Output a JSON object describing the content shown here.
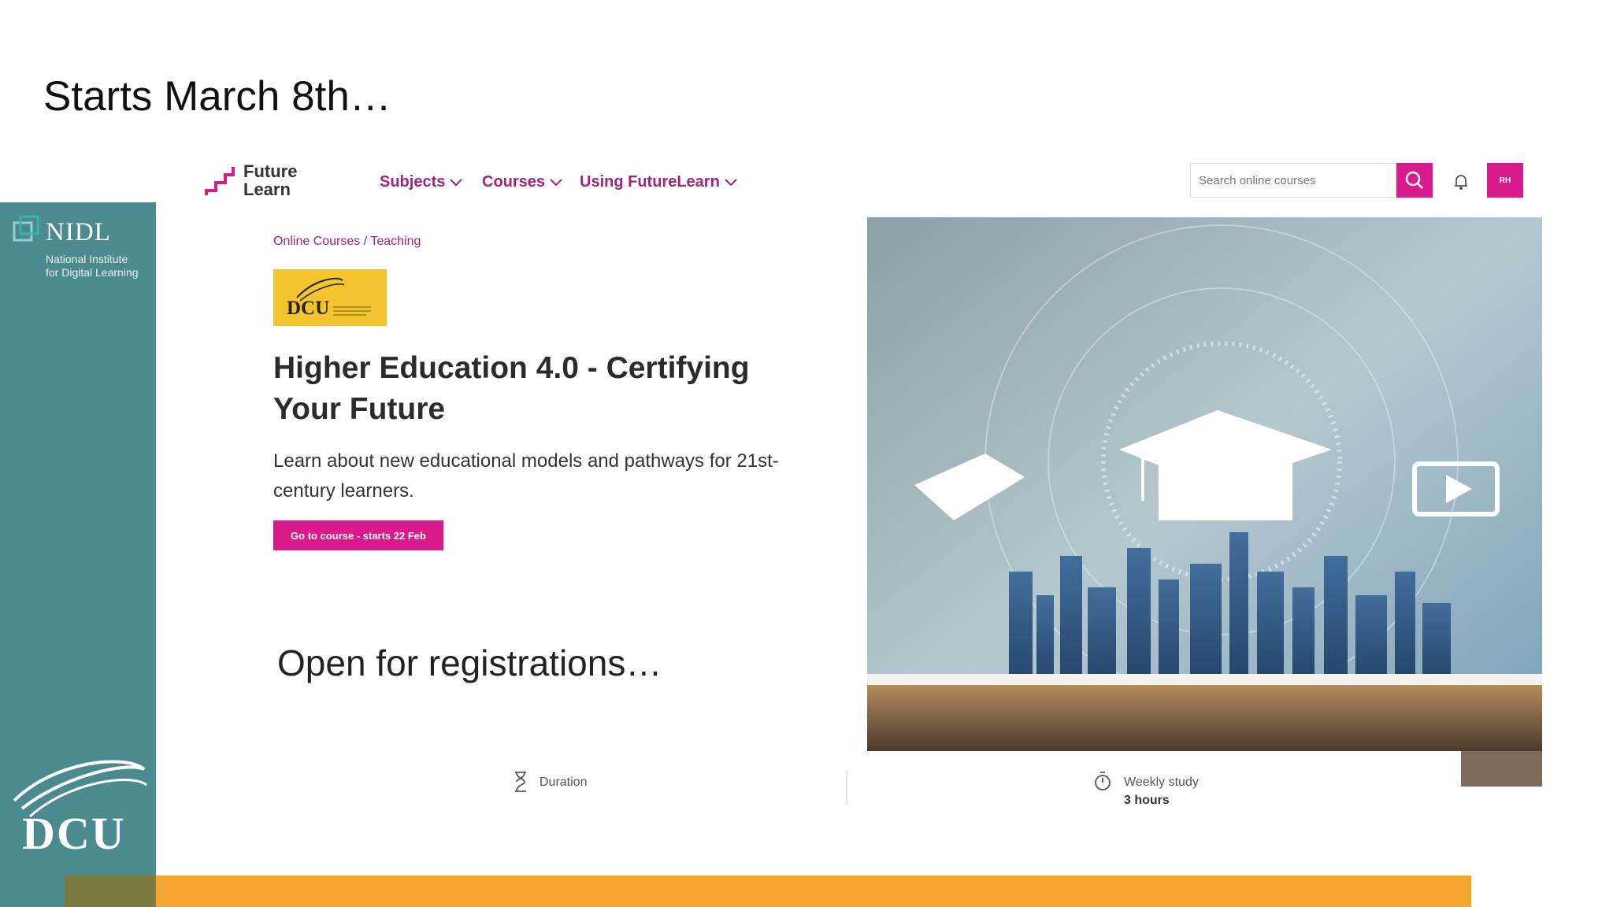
{
  "slide": {
    "title": "Starts March 8th…",
    "footer_note": "Open for registrations…"
  },
  "sidebar": {
    "org_name": "NIDL",
    "org_subtitle_line1": "National Institute",
    "org_subtitle_line2": "for Digital Learning",
    "university": "DCU"
  },
  "nav": {
    "logo_line1": "Future",
    "logo_line2": "Learn",
    "menu": [
      {
        "label": "Subjects"
      },
      {
        "label": "Courses"
      },
      {
        "label": "Using FutureLearn"
      }
    ],
    "search_placeholder": "Search online courses",
    "avatar_initials": "RH"
  },
  "course": {
    "breadcrumb": "Online Courses / Teaching",
    "partner_logo_text": "DCU",
    "title": "Higher Education 4.0 - Certifying Your Future",
    "description": "Learn about new educational models and pathways for 21st-century learners.",
    "cta_label": "Go to course - starts 22 Feb"
  },
  "stats": {
    "duration_label": "Duration",
    "weekly_label": "Weekly study",
    "weekly_value": "3 hours"
  },
  "colors": {
    "brand_pink": "#d91a8c",
    "sidebar_teal": "#4b8a8f",
    "bottom_orange": "#f4a52d",
    "dcu_gold": "#f4c42e"
  }
}
